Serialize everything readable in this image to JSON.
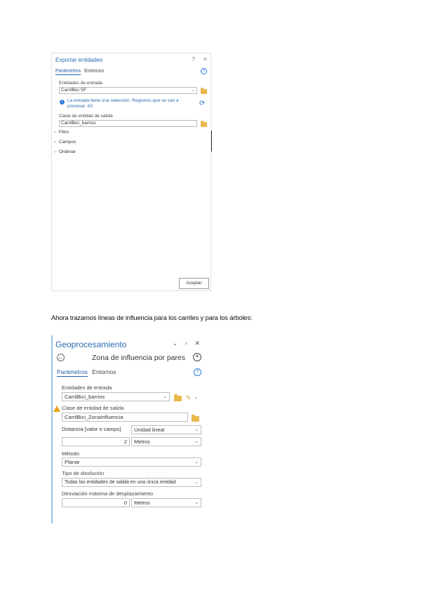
{
  "export_panel": {
    "title": "Exportar entidades",
    "help_glyph": "?",
    "close_glyph": "×",
    "tabs": [
      "Parámetros",
      "Entornos"
    ],
    "input_label": "Entidades de entrada",
    "input_value": "CarrilBici SF",
    "info_message": "La entrada tiene una selección. Registros que se van a procesar: 63",
    "output_label": "Clase de entidad de salida",
    "output_value": "CarrilBici_barrios",
    "sections": [
      "Filtro",
      "Campos",
      "Ordenar"
    ],
    "accept_label": "Aceptar",
    "icons": {
      "help": "help-circle-icon",
      "info": "info-icon",
      "refresh": "refresh-icon",
      "folder": "folder-icon"
    },
    "colors": {
      "accent": "#2b6cb0",
      "folder": "#e9b84a"
    }
  },
  "caption": "Ahora trazamos líneas de influencia para los carriles y para los árboles:",
  "geo_panel": {
    "title": "Geoprocesamiento",
    "window_controls": "⌄ ▫ ✕",
    "back_glyph": "←",
    "add_glyph": "+",
    "tool_name": "Zona de influencia por pares",
    "tabs": [
      "Parámetros",
      "Entornos"
    ],
    "help_glyph": "?",
    "input_label": "Entidades de entrada",
    "input_value": "CarrilBici_barrios",
    "output_label": "Clase de entidad de salida",
    "output_value": "CarrilBici_ZonaInfluencia",
    "distance_label": "Distancia [valor o campo]",
    "unit_type_value": "Unidad lineal",
    "distance_value": "2",
    "distance_unit": "Metros",
    "method_label": "Método",
    "method_value": "Planar",
    "dissolve_label": "Tipo de disolución",
    "dissolve_value": "Todas las entidades de salida en una única entidad",
    "offset_label": "Desviación máxima de desplazamiento",
    "offset_value": "0",
    "offset_unit": "Metros",
    "icons": {
      "warning": "warning-icon",
      "pencil": "pencil-icon",
      "folder": "folder-icon"
    },
    "colors": {
      "accent": "#2b6cb0",
      "warning": "#e8a317"
    }
  }
}
